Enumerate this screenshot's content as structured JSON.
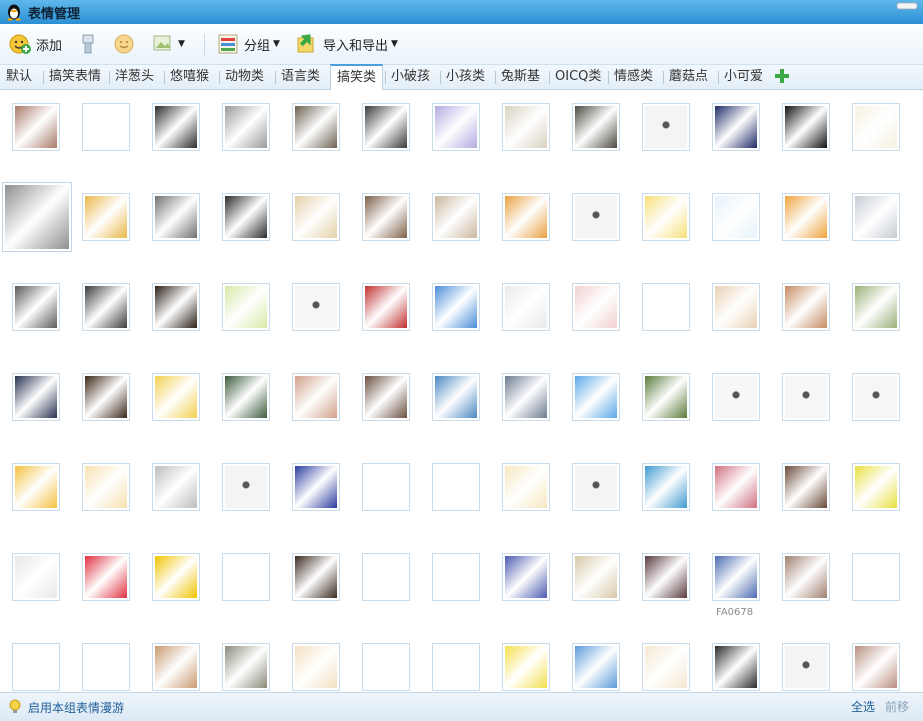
{
  "window": {
    "title": "表情管理"
  },
  "toolbar": {
    "add_label": "添加",
    "group_label": "分组",
    "import_export_label": "导入和导出"
  },
  "tabs": [
    "默认",
    "搞笑表情",
    "洋葱头",
    "悠嘻猴",
    "动物类",
    "语言类",
    "搞笑类",
    "小破孩",
    "小孩类",
    "兔斯基",
    "OICQ类",
    "情感类",
    "蘑菇点",
    "小可爱"
  ],
  "active_tab": "搞笑类",
  "grid": {
    "hover_caption": "FA0678",
    "rows": [
      [
        "#a87a68",
        "#ffffff",
        "#2b2b2b",
        "#9a9a9a",
        "#6a6050",
        "#3a3a3a",
        "#b3aae0",
        "#d9d2c0",
        "#4a4a40",
        "#f4f4f4",
        "#1e2a66",
        "#111111",
        "#f5f0e0"
      ],
      [
        "#8f8f8f",
        "#e8b84a",
        "#707070",
        "#2b2b2b",
        "#e3d0a8",
        "#7d6048",
        "#c9b7a0",
        "#e8a040",
        "#f4f4f4",
        "#f7e07a",
        "#e6f2fa",
        "#f0a33c",
        "#c6ccd4"
      ],
      [
        "#5a5a5a",
        "#3c3c3c",
        "#2a2018",
        "#d6e9a8",
        "#f6f6f6",
        "#c03030",
        "#4a8ed8",
        "#eaeaea",
        "#f2d0d0",
        "#ffffff",
        "#e8d2b4",
        "#c68a62",
        "#9ab07a"
      ],
      [
        "#263050",
        "#3a2818",
        "#f2d050",
        "#3a5a3a",
        "#d0a088",
        "#6a5040",
        "#4a88c0",
        "#6a7a90",
        "#5aa8e8",
        "#5a7a3a",
        "#f6f6f6",
        "#f6f6f6",
        "#f6f6f6"
      ],
      [
        "#f4c040",
        "#f6e0b0",
        "#bdbdbd",
        "#f4f4f4",
        "#2a3ca0",
        "#ffffff",
        "#ffffff",
        "#f6e8c0",
        "#f4f4f4",
        "#3e9ad0",
        "#d07080",
        "#6a4a3a",
        "#e8e040"
      ],
      [
        "#e8e8e8",
        "#e03040",
        "#f1c400",
        "#ffffff",
        "#3a2a20",
        "#ffffff",
        "#ffffff",
        "#4a5ab0",
        "#d8c8a8",
        "#5a3a40",
        "#4a6ab0",
        "#a08070",
        "#ffffff"
      ],
      [
        "#ffffff",
        "#ffffff",
        "#c89a70",
        "#8a8a7a",
        "#f4e0c0",
        "#ffffff",
        "#ffffff",
        "#f4e050",
        "#5a9ad8",
        "#f4e8d0",
        "#2a2a2a",
        "#f4f4f4",
        "#b89080"
      ]
    ]
  },
  "statusbar": {
    "roam_label": "启用本组表情漫游",
    "select_all_label": "全选",
    "move_label": "前移"
  }
}
